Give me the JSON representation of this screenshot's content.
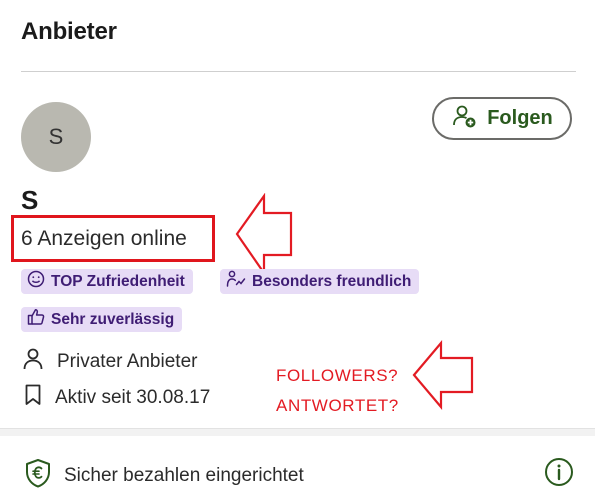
{
  "section": {
    "title": "Anbieter"
  },
  "seller": {
    "avatar_letter": "S",
    "name": "S",
    "ads_online": "6 Anzeigen online",
    "follow_label": "Folgen"
  },
  "badges": [
    {
      "label": "TOP Zufriedenheit",
      "icon": "smiley-icon"
    },
    {
      "label": "Besonders freundlich",
      "icon": "friendly-hand-icon"
    },
    {
      "label": "Sehr zuverlässig",
      "icon": "thumbs-up-icon"
    }
  ],
  "details": {
    "type": "Privater Anbieter",
    "active_since": "Aktiv seit 30.08.17"
  },
  "annotations": {
    "line1": "FOLLOWERS?",
    "line2": "ANTWORTET?"
  },
  "payment": {
    "label": "Sicher bezahlen eingerichtet"
  },
  "colors": {
    "accent_green": "#2a5a1e",
    "badge_bg": "#e7dcf6",
    "badge_text": "#3f1d74",
    "annotation_red": "#e31b23"
  }
}
